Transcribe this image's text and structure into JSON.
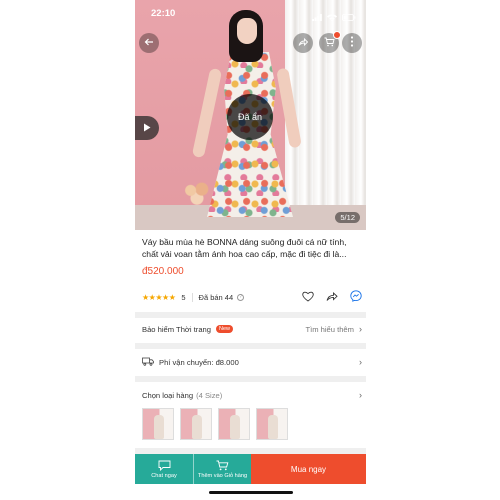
{
  "status_bar": {
    "time": "22:10"
  },
  "product": {
    "hidden_label": "Đã ẩn",
    "image_counter": "5/12",
    "title": "Váy bầu mùa hè BONNA dáng suông đuôi cá nữ tính, chất vải voan tằm ánh hoa cao cấp, mặc đi tiệc đi là...",
    "price": "đ520.000",
    "rating_stars": "★★★★★",
    "rating_value": "5",
    "sold": "Đã bán 44",
    "rating_info_icon": "?"
  },
  "insurance": {
    "label": "Bảo hiểm Thời trang",
    "badge": "New",
    "link": "Tìm hiểu thêm"
  },
  "shipping": {
    "label": "Phí vận chuyển: đ8.000"
  },
  "variants": {
    "label": "Chọn loại hàng",
    "count": "(4 Size)",
    "thumbnails": 4
  },
  "bottom_bar": {
    "chat": "Chat ngay",
    "add_to_cart": "Thêm vào Giỏ hàng",
    "buy_now": "Mua ngay"
  },
  "icons": {
    "back": "arrow-left-icon",
    "share": "share-icon",
    "cart": "cart-icon",
    "more": "more-vertical-icon",
    "play": "play-icon",
    "heart": "heart-icon",
    "truck": "truck-icon",
    "chat": "chat-icon"
  },
  "colors": {
    "accent": "#ee4d2d",
    "teal": "#26aa99",
    "star": "#f6a700"
  }
}
